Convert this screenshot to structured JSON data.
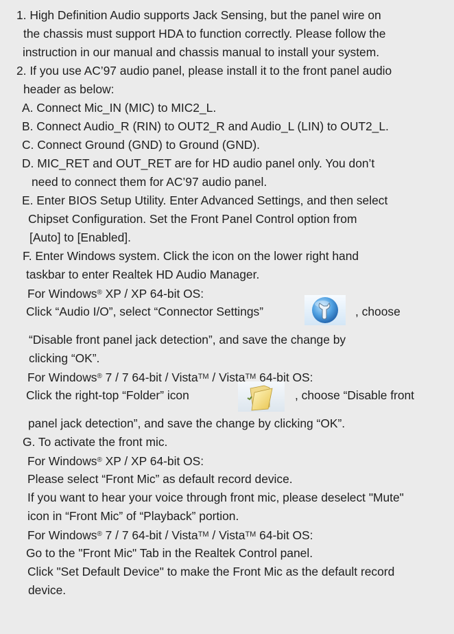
{
  "doc": {
    "item1": {
      "l1": "1. High Definition Audio supports Jack Sensing, but the panel wire on",
      "l2": "the chassis must support HDA to function correctly. Please follow the",
      "l3": "instruction in our manual and chassis manual to install your system."
    },
    "item2": {
      "l1": "2. If you use AC’97 audio panel, please install it to the front panel audio",
      "l2": "header as below:"
    },
    "stepA": "A. Connect Mic_IN (MIC) to MIC2_L.",
    "stepB": "B. Connect Audio_R (RIN) to OUT2_R and Audio_L (LIN) to OUT2_L.",
    "stepC": "C. Connect Ground (GND) to Ground (GND).",
    "stepD": {
      "l1": "D. MIC_RET and OUT_RET are for HD audio panel only. You don’t",
      "l2": "need to connect them for AC’97 audio panel."
    },
    "stepE": {
      "l1": "E. Enter BIOS Setup Utility. Enter Advanced Settings, and then select",
      "l2": "Chipset Configuration. Set the Front Panel Control option from",
      "l3": "[Auto] to [Enabled]."
    },
    "stepF": {
      "l1": "F. Enter Windows system. Click the icon on the lower right hand",
      "l2": "taskbar to enter Realtek HD Audio Manager.",
      "winxp_a": "For Windows",
      "reg": "®",
      "winxp_b": " XP / XP 64-bit OS:",
      "xp_click_a": "Click “Audio I/O”, select “Connector Settings”",
      "xp_click_b": ", choose",
      "xp_l2": "“Disable front panel jack detection”, and save the change by",
      "xp_l3": "clicking “OK”.",
      "win7_a": "For Windows",
      "win7_b": " 7 / 7 64-bit / Vista",
      "tm": "TM",
      "win7_c": " / Vista",
      "win7_d": " 64-bit OS:",
      "w7_click_a": "Click the right-top “Folder” icon",
      "w7_click_b": ", choose “Disable front",
      "w7_l2": "panel jack detection”, and save the change by clicking “OK”."
    },
    "stepG": {
      "l1": "G. To activate the front mic.",
      "winxp_a": "For Windows",
      "winxp_b": " XP / XP 64-bit OS:",
      "xp_l1": "Please select “Front Mic” as default record device.",
      "xp_l2": "If you want to hear your voice through front mic, please deselect \"Mute\"",
      "xp_l3": "icon in “Front Mic” of “Playback” portion.",
      "win7_a": "For Windows",
      "win7_b": " 7 / 7 64-bit / Vista",
      "win7_c": " / Vista",
      "win7_d": " 64-bit OS:",
      "w7_l1": "Go to the \"Front Mic\" Tab in the Realtek Control panel.",
      "w7_l2": "Click \"Set Default Device\" to make the Front Mic as the default record",
      "w7_l3": "device."
    }
  },
  "icons": {
    "connector_settings": "connector-settings-icon",
    "folder": "folder-icon"
  }
}
